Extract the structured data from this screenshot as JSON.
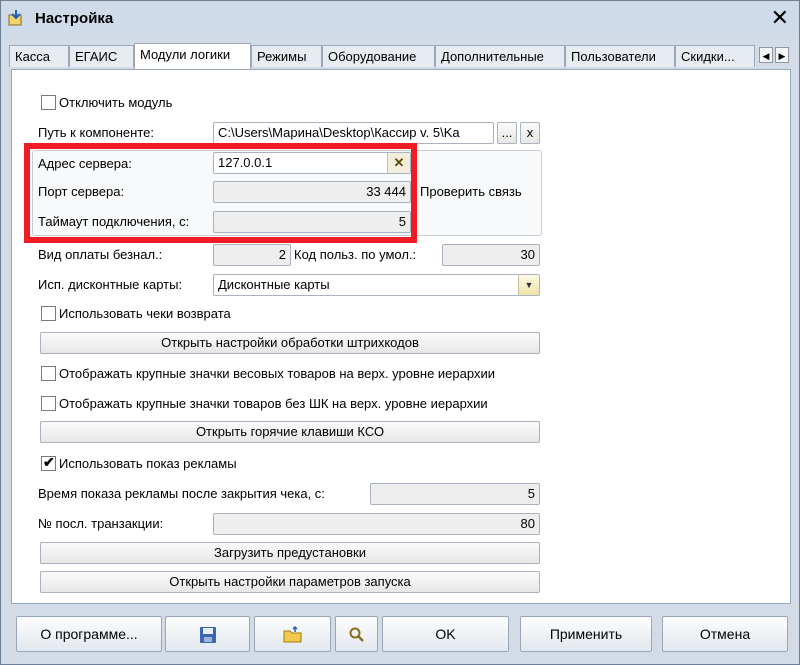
{
  "window": {
    "title": "Настройка",
    "close_glyph": "✕"
  },
  "tabs": [
    {
      "label": "Касса"
    },
    {
      "label": "ЕГАИС"
    },
    {
      "label": "Модули логики"
    },
    {
      "label": "Режимы"
    },
    {
      "label": "Оборудование"
    },
    {
      "label": "Дополнительные"
    },
    {
      "label": "Пользователи"
    },
    {
      "label": "Скидки..."
    }
  ],
  "tab_scroll": {
    "left": "◀",
    "right": "▶"
  },
  "module": {
    "disable_label": "Отключить модуль",
    "disable_checked": false,
    "path_label": "Путь к компоненте:",
    "path_value": "C:\\Users\\Марина\\Desktop\\Кассир v. 5\\Ka",
    "path_browse": "...",
    "path_clear": "x"
  },
  "server": {
    "address_label": "Адрес сервера:",
    "address_value": "127.0.0.1",
    "clear_glyph": "✕",
    "port_label": "Порт сервера:",
    "port_value": "33 444",
    "timeout_label": "Таймаут подключения, с:",
    "timeout_value": "5",
    "check_label": "Проверить связь"
  },
  "payment": {
    "cashless_label": "Вид оплаты безнал.:",
    "cashless_value": "2",
    "user_code_label": "Код польз. по умол.:",
    "user_code_value": "30"
  },
  "discount": {
    "label": "Исп. дисконтные карты:",
    "value": "Дисконтные карты"
  },
  "options": {
    "returns_label": "Использовать чеки возврата",
    "returns_checked": false,
    "barcode_button": "Открыть настройки обработки штрихкодов",
    "weight_icons_label": "Отображать крупные значки весовых товаров на верх. уровне иерархии",
    "weight_icons_checked": false,
    "nobarcode_icons_label": "Отображать крупные значки товаров без ШК на верх. уровне иерархии",
    "nobarcode_icons_checked": false,
    "hotkeys_button": "Открыть горячие клавиши КСО",
    "ads_label": "Использовать показ рекламы",
    "ads_checked": true,
    "check_glyph": "✔",
    "ads_time_label": "Время показа рекламы после закрытия чека, с:",
    "ads_time_value": "5",
    "last_tx_label": "№ посл. транзакции:",
    "last_tx_value": "80",
    "presets_button": "Загрузить предустановки",
    "launch_button": "Открыть настройки параметров запуска"
  },
  "footer": {
    "about": "О программе...",
    "ok": "OK",
    "apply": "Применить",
    "cancel": "Отмена"
  },
  "colors": {
    "highlight": "#ef1c25",
    "accent": "#f0c419"
  }
}
